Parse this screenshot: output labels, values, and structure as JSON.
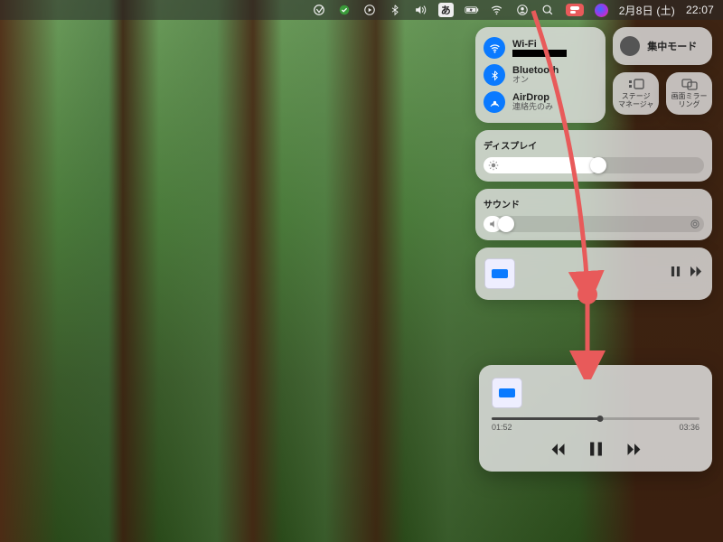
{
  "menubar": {
    "ime": "あ",
    "date": "2月8日 (土)",
    "time": "22:07"
  },
  "cc": {
    "wifi": {
      "title": "Wi-Fi"
    },
    "bluetooth": {
      "title": "Bluetooth",
      "status": "オン"
    },
    "airdrop": {
      "title": "AirDrop",
      "status": "連絡先のみ"
    },
    "focus": "集中モード",
    "stage": "ステージ\nマネージャ",
    "mirror": "画面ミラーリング",
    "display": {
      "label": "ディスプレイ",
      "percent": 52
    },
    "sound": {
      "label": "サウンド",
      "percent": 8
    }
  },
  "media": {
    "elapsed": "01:52",
    "total": "03:36",
    "percent": 52
  },
  "colors": {
    "accent": "#e85a5a",
    "blue": "#0a7aff"
  }
}
